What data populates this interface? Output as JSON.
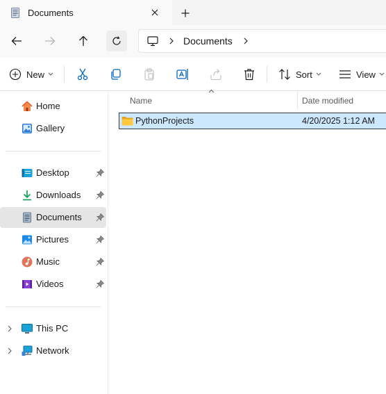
{
  "window": {
    "tab_title": "Documents",
    "tab_icon": "document-icon",
    "close_icon": "close-icon",
    "new_tab_icon": "plus-icon"
  },
  "navigation": {
    "back_icon": "arrow-left-icon",
    "forward_icon": "arrow-right-icon",
    "up_icon": "arrow-up-icon",
    "refresh_icon": "refresh-icon",
    "address": {
      "root_icon": "this-pc-icon",
      "crumbs": [
        "Documents"
      ]
    }
  },
  "toolbar": {
    "new_label": "New",
    "sort_label": "Sort",
    "view_label": "View",
    "icons": [
      "cut-icon",
      "copy-icon",
      "paste-icon",
      "rename-icon",
      "share-icon",
      "delete-icon"
    ]
  },
  "sidebar": {
    "quick": [
      {
        "label": "Home",
        "icon": "home-icon"
      },
      {
        "label": "Gallery",
        "icon": "gallery-icon"
      }
    ],
    "pinned": [
      {
        "label": "Desktop",
        "icon": "desktop-icon",
        "pinned": true
      },
      {
        "label": "Downloads",
        "icon": "downloads-icon",
        "pinned": true
      },
      {
        "label": "Documents",
        "icon": "documents-icon",
        "pinned": true,
        "selected": true
      },
      {
        "label": "Pictures",
        "icon": "pictures-icon",
        "pinned": true
      },
      {
        "label": "Music",
        "icon": "music-icon",
        "pinned": true
      },
      {
        "label": "Videos",
        "icon": "videos-icon",
        "pinned": true
      }
    ],
    "locations": [
      {
        "label": "This PC",
        "icon": "this-pc-icon"
      },
      {
        "label": "Network",
        "icon": "network-icon"
      }
    ]
  },
  "file_list": {
    "columns": {
      "name": "Name",
      "date": "Date modified"
    },
    "rows": [
      {
        "name": "PythonProjects",
        "date": "4/20/2025 1:12 AM",
        "type": "folder",
        "selected": true
      }
    ]
  },
  "colors": {
    "accent": "#0067c0",
    "selection": "#cce8ff",
    "folder": "#ffc83d"
  }
}
